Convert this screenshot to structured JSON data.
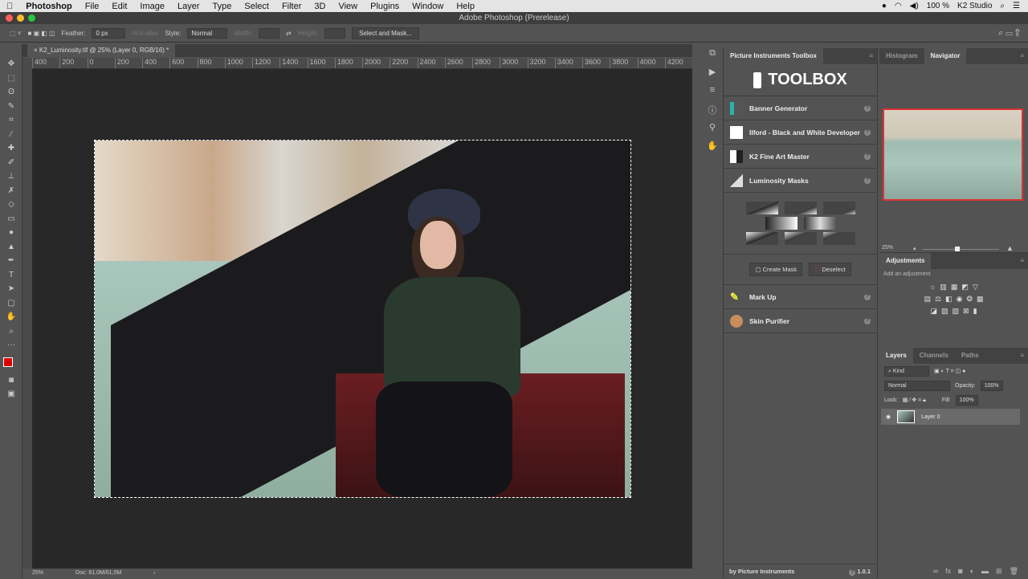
{
  "menubar": {
    "apple": "",
    "app": "Photoshop",
    "items": [
      "File",
      "Edit",
      "Image",
      "Layer",
      "Type",
      "Select",
      "Filter",
      "3D",
      "View",
      "Plugins",
      "Window",
      "Help"
    ],
    "battery": "100 %",
    "user": "K2 Studio"
  },
  "window": {
    "title": "Adobe Photoshop (Prerelease)"
  },
  "options": {
    "feather_label": "Feather:",
    "feather_value": "0 px",
    "anti_alias": "Anti-alias",
    "style_label": "Style:",
    "style_value": "Normal",
    "width_label": "Width:",
    "height_label": "Height:",
    "select_mask": "Select and Mask..."
  },
  "document": {
    "tab": "K2_Luminosity.tif @ 25% (Layer 0, RGB/16) *",
    "ruler": [
      "400",
      "200",
      "0",
      "200",
      "400",
      "600",
      "800",
      "1000",
      "1200",
      "1400",
      "1600",
      "1800",
      "2000",
      "2200",
      "2400",
      "2600",
      "2800",
      "3000",
      "3200",
      "3400",
      "3600",
      "3800",
      "4000",
      "4200"
    ],
    "zoom": "25%",
    "doc": "Doc: 61,0M/61,0M",
    "more": "›"
  },
  "toolbox": {
    "tab": "Picture Instruments Toolbox",
    "logo": "TOOLBOX",
    "plugins": [
      {
        "name": "Banner Generator"
      },
      {
        "name": "Ilford - Black and White Developer"
      },
      {
        "name": "K2 Fine Art Master"
      },
      {
        "name": "Luminosity Masks"
      }
    ],
    "plugins2": [
      {
        "name": "Mark Up"
      },
      {
        "name": "Skin Purifier"
      }
    ],
    "create_mask": "Create Mask",
    "deselect": "Deselect",
    "footer": "by Picture Instruments",
    "version": "1.0.1",
    "help": "?"
  },
  "navigator": {
    "tabs": [
      "Histogram",
      "Navigator"
    ],
    "zoom": "25%",
    "zoom_fraction": 0.45
  },
  "adjustments": {
    "tab": "Adjustments",
    "hint": "Add an adjustment"
  },
  "layers": {
    "tabs": [
      "Layers",
      "Channels",
      "Paths"
    ],
    "filter": "Kind",
    "blend": "Normal",
    "opacity_label": "Opacity:",
    "opacity": "100%",
    "lock_label": "Lock:",
    "fill_label": "Fill:",
    "fill": "100%",
    "layer_name": "Layer 0"
  }
}
